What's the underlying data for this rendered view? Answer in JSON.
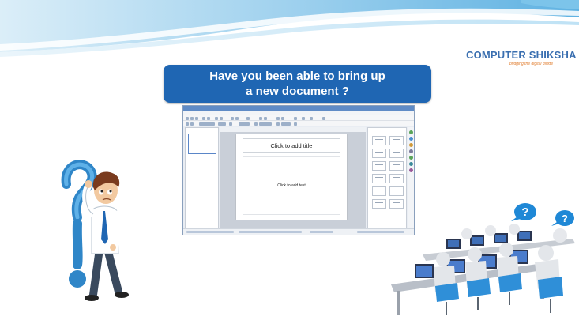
{
  "slide": {
    "title_line1": "Have you been able to bring up",
    "title_line2": "a new document ?",
    "colors": {
      "banner": "#1f66b3",
      "swoosh_light": "#cfe6f4",
      "swoosh_mid": "#7fc0e6",
      "logo_blue": "#3a6fb0",
      "logo_orange": "#e07a2a"
    }
  },
  "logo": {
    "name": "COMPUTER SHIKSHA",
    "tagline": "bridging the digital divide"
  },
  "screenshot": {
    "title_placeholder": "Click to add title",
    "text_placeholder": "Click to add text"
  },
  "decorations": {
    "left_figure": "confused-man-with-question-mark-icon",
    "right_figure": "computer-lab-students-icon",
    "bubbles": [
      "?",
      "?"
    ]
  }
}
